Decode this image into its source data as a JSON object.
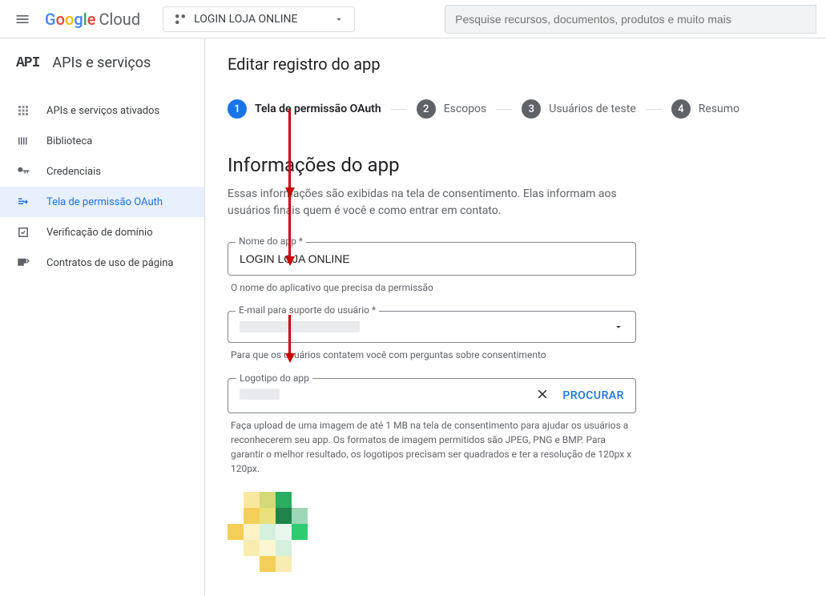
{
  "topbar": {
    "logo_cloud": "Cloud",
    "project_name": "LOGIN LOJA ONLINE",
    "search_placeholder": "Pesquise recursos, documentos, produtos e muito mais"
  },
  "sidebar": {
    "title": "APIs e serviços",
    "items": [
      {
        "label": "APIs e serviços ativados"
      },
      {
        "label": "Biblioteca"
      },
      {
        "label": "Credenciais"
      },
      {
        "label": "Tela de permissão OAuth"
      },
      {
        "label": "Verificação de domínio"
      },
      {
        "label": "Contratos de uso de página"
      }
    ]
  },
  "main": {
    "page_title": "Editar registro do app",
    "steps": [
      {
        "num": "1",
        "label": "Tela de permissão OAuth"
      },
      {
        "num": "2",
        "label": "Escopos"
      },
      {
        "num": "3",
        "label": "Usuários de teste"
      },
      {
        "num": "4",
        "label": "Resumo"
      }
    ],
    "section_title": "Informações do app",
    "section_desc": "Essas informações são exibidas na tela de consentimento. Elas informam aos usuários finais quem é você e como entrar em contato.",
    "app_name_label": "Nome do app *",
    "app_name_value": "LOGIN LOJA ONLINE",
    "app_name_hint": "O nome do aplicativo que precisa da permissão",
    "support_email_label": "E-mail para suporte do usuário *",
    "support_email_hint": "Para que os usuários contatem você com perguntas sobre consentimento",
    "logo_label": "Logotipo do app",
    "logo_browse": "PROCURAR",
    "logo_hint": "Faça upload de uma imagem de até 1 MB na tela de consentimento para ajudar os usuários a reconhecerem seu app. Os formatos de imagem permitidos são JPEG, PNG e BMP. Para garantir o melhor resultado, os logotipos precisam ser quadrados e ter a resolução de 120px x 120px."
  }
}
